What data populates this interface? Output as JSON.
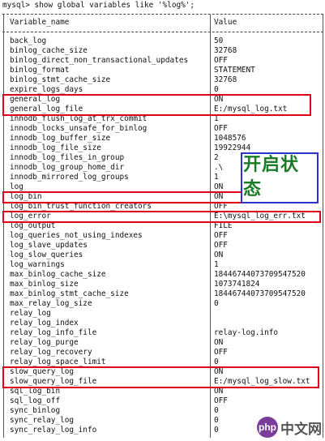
{
  "terminal": {
    "command": "mysql> show global variables like '%log%';",
    "header": {
      "name": "Variable_name",
      "value": "Value"
    },
    "rows": [
      {
        "name": "back_log",
        "value": "50"
      },
      {
        "name": "binlog_cache_size",
        "value": "32768"
      },
      {
        "name": "binlog_direct_non_transactional_updates",
        "value": "OFF"
      },
      {
        "name": "binlog_format",
        "value": "STATEMENT"
      },
      {
        "name": "binlog_stmt_cache_size",
        "value": "32768"
      },
      {
        "name": "expire_logs_days",
        "value": "0"
      },
      {
        "name": "general_log",
        "value": "ON"
      },
      {
        "name": "general_log_file",
        "value": "E:/mysql_log.txt"
      },
      {
        "name": "innodb_flush_log_at_trx_commit",
        "value": "1"
      },
      {
        "name": "innodb_locks_unsafe_for_binlog",
        "value": "OFF"
      },
      {
        "name": "innodb_log_buffer_size",
        "value": "1048576"
      },
      {
        "name": "innodb_log_file_size",
        "value": "19922944"
      },
      {
        "name": "innodb_log_files_in_group",
        "value": "2"
      },
      {
        "name": "innodb_log_group_home_dir",
        "value": ".\\"
      },
      {
        "name": "innodb_mirrored_log_groups",
        "value": "1"
      },
      {
        "name": "log",
        "value": "ON"
      },
      {
        "name": "log_bin",
        "value": "ON"
      },
      {
        "name": "log_bin_trust_function_creators",
        "value": "OFF"
      },
      {
        "name": "log_error",
        "value": "E:\\mysql_log_err.txt"
      },
      {
        "name": "log_output",
        "value": "FILE"
      },
      {
        "name": "log_queries_not_using_indexes",
        "value": "OFF"
      },
      {
        "name": "log_slave_updates",
        "value": "OFF"
      },
      {
        "name": "log_slow_queries",
        "value": "ON"
      },
      {
        "name": "log_warnings",
        "value": "1"
      },
      {
        "name": "max_binlog_cache_size",
        "value": "18446744073709547520"
      },
      {
        "name": "max_binlog_size",
        "value": "1073741824"
      },
      {
        "name": "max_binlog_stmt_cache_size",
        "value": "18446744073709547520"
      },
      {
        "name": "max_relay_log_size",
        "value": "0"
      },
      {
        "name": "relay_log",
        "value": ""
      },
      {
        "name": "relay_log_index",
        "value": ""
      },
      {
        "name": "relay_log_info_file",
        "value": "relay-log.info"
      },
      {
        "name": "relay_log_purge",
        "value": "ON"
      },
      {
        "name": "relay_log_recovery",
        "value": "OFF"
      },
      {
        "name": "relay_log_space_limit",
        "value": "0"
      },
      {
        "name": "slow_query_log",
        "value": "ON"
      },
      {
        "name": "slow_query_log_file",
        "value": "E:/mysql_log_slow.txt"
      },
      {
        "name": "sql_log_bin",
        "value": "ON"
      },
      {
        "name": "sql_log_off",
        "value": "OFF"
      },
      {
        "name": "sync_binlog",
        "value": "0"
      },
      {
        "name": "sync_relay_log",
        "value": "0"
      },
      {
        "name": "sync_relay_log_info",
        "value": "0"
      }
    ]
  },
  "annotation": {
    "label": "开启状态",
    "label_color": "#1a7a25",
    "box_color": "#2a35c8",
    "highlight_color": "#e0001b"
  },
  "watermark": {
    "logo_text": "php",
    "site_text": "中文网"
  }
}
